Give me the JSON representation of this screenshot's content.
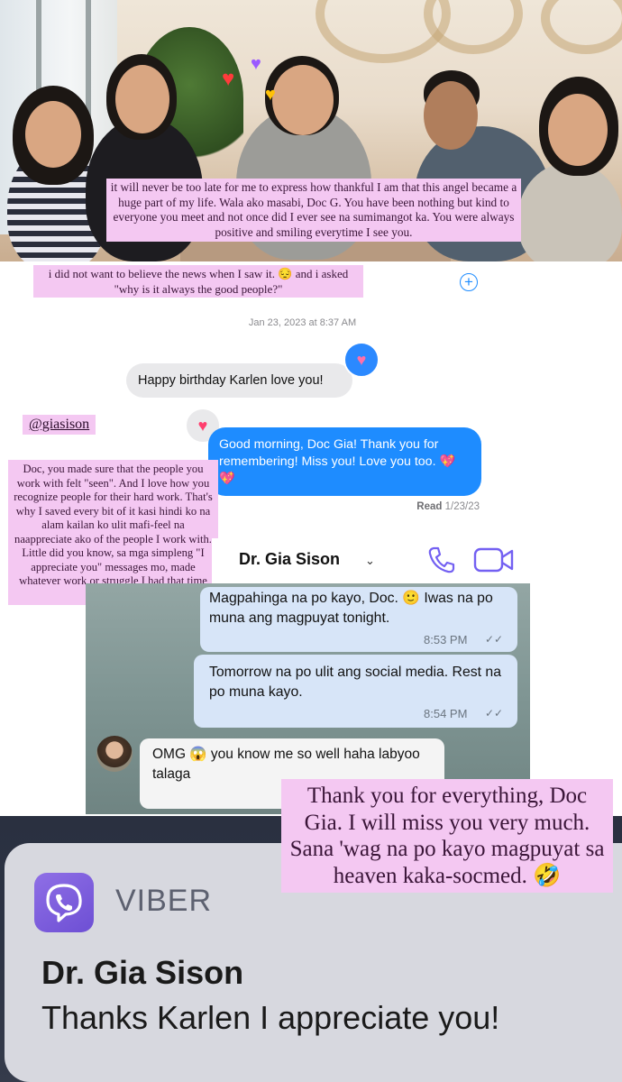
{
  "captions": {
    "cap1": "it will never be too late for me to express how thankful I am that this angel became a huge part of my life. Wala ako masabi, Doc G. You have been nothing but kind to everyone you meet and not once did I ever see na sumimangot ka. You were always positive and smiling everytime I see you.",
    "cap2": "i did not want to believe the news when I saw it. 😔 and i asked \"why is it always the good people?\"",
    "mention": "@giasison",
    "cap3": "Doc, you made sure that the people you work with felt \"seen\". And I love how you recognize people for their hard work. That's why I saved every bit of it kasi hindi ko na alam kailan ko ulit mafi-feel na naappreciate ako of the people I work with. Little did you know, sa mga simpleng \"I appreciate you\" messages mo, made whatever work or struggle I had that time bearable.",
    "cap4": "Thank you for everything, Doc Gia. I will miss you very much. Sana 'wag na po kayo magpuyat sa heaven kaka-socmed. 🤣"
  },
  "imessage": {
    "plus_icon": "+",
    "date": "Jan 23, 2023 at 8:37 AM",
    "received": "Happy birthday Karlen love you!",
    "sent": "Good morning, Doc Gia! Thank you for remembering! Miss you! Love you too. 💖💖",
    "read_label": "Read",
    "read_date": "1/23/23",
    "tapback": "♥"
  },
  "viber_chat": {
    "contact_name": "Dr. Gia Sison",
    "chevron": "⌄",
    "messages": [
      {
        "text": "Magpahinga na po kayo, Doc. 🙂 Iwas na po muna ang magpuyat tonight.",
        "time": "8:53 PM",
        "status": "✓✓"
      },
      {
        "text": "Tomorrow na po ulit ang social media. Rest na po muna kayo.",
        "time": "8:54 PM",
        "status": "✓✓"
      },
      {
        "text": "OMG 😱 you know me so well haha labyoo talaga"
      }
    ]
  },
  "notification": {
    "app": "VIBER",
    "title": "Dr. Gia Sison",
    "message": "Thanks Karlen I appreciate you!"
  },
  "colors": {
    "caption_bg": "#f4c8f2",
    "imessage_blue": "#1e8cff",
    "viber_purple": "#7360f2"
  }
}
